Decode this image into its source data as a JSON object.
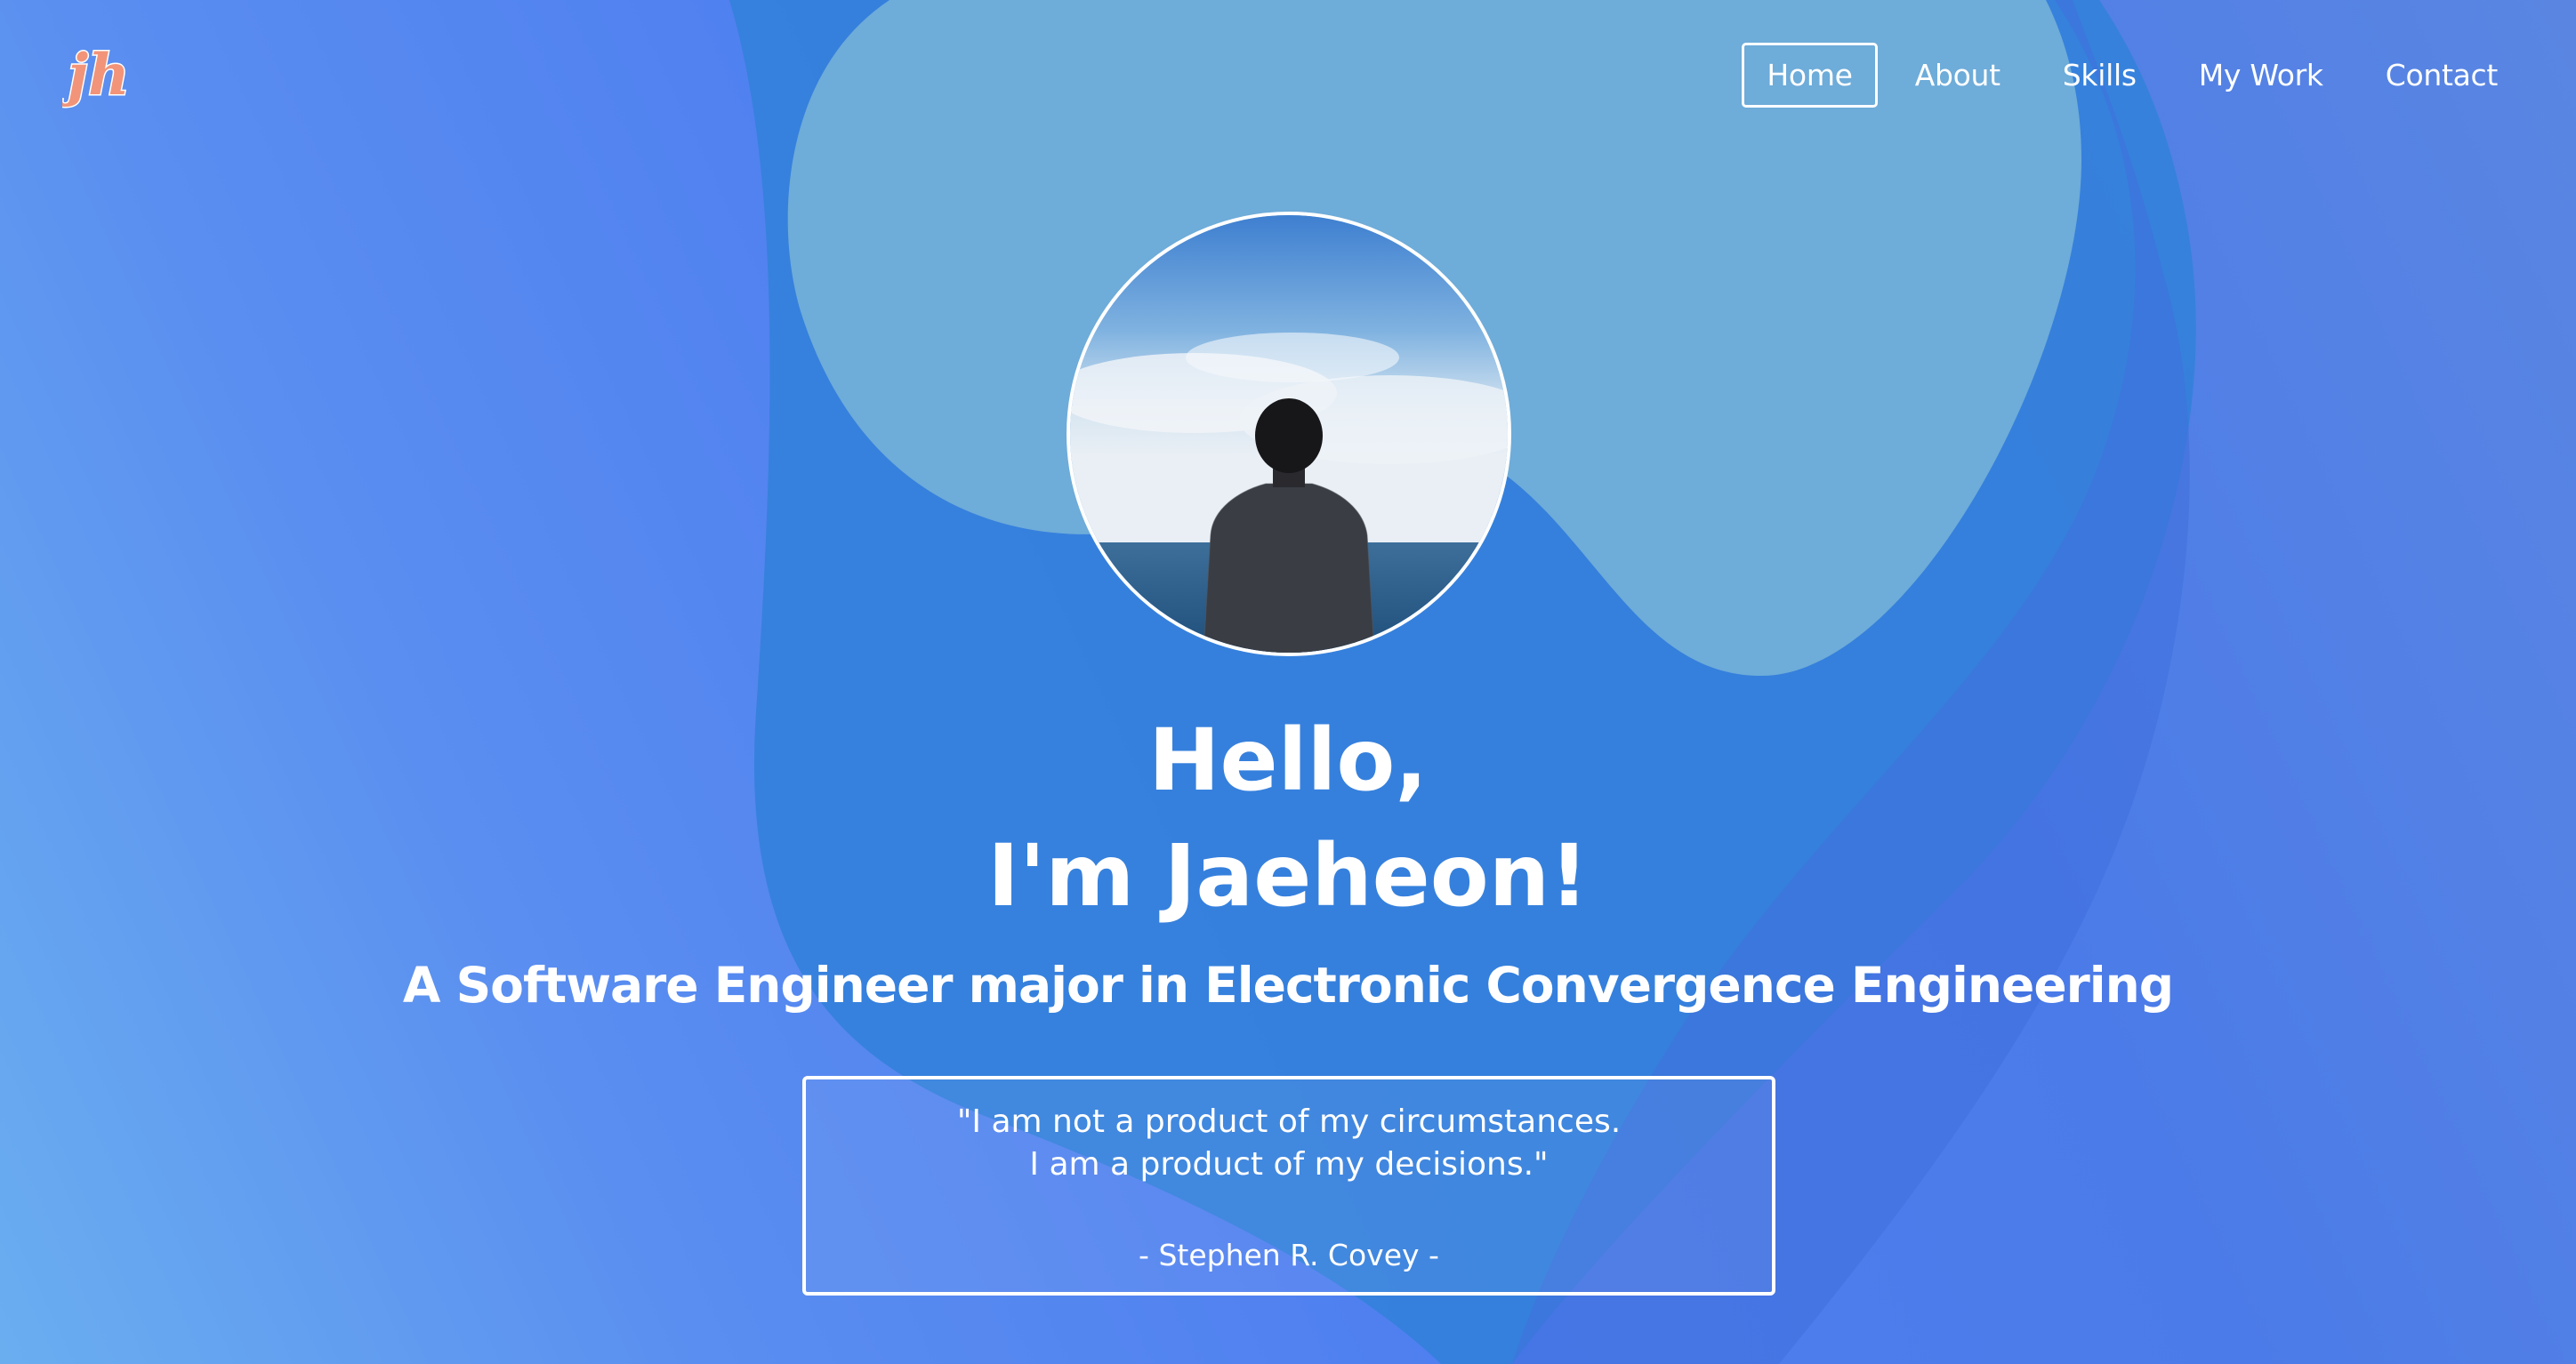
{
  "logo": {
    "text": "jh",
    "icon": "jh-logo-icon"
  },
  "nav": {
    "items": [
      {
        "label": "Home",
        "active": true
      },
      {
        "label": "About",
        "active": false
      },
      {
        "label": "Skills",
        "active": false
      },
      {
        "label": "My Work",
        "active": false
      },
      {
        "label": "Contact",
        "active": false
      }
    ]
  },
  "hero": {
    "greeting_line1": "Hello,",
    "greeting_line2": "I'm Jaeheon!",
    "subtitle": "A Software Engineer major in Electronic Convergence Engineering"
  },
  "quote": {
    "line1": "\"I am not a product of my circumstances.",
    "line2": "I am a product of my decisions.\"",
    "author": "- Stephen R. Covey -"
  },
  "colors": {
    "background_primary": "#4f7ff0",
    "background_light": "#6aaef0",
    "text": "#ffffff",
    "logo_accent": "#f7a98c"
  }
}
